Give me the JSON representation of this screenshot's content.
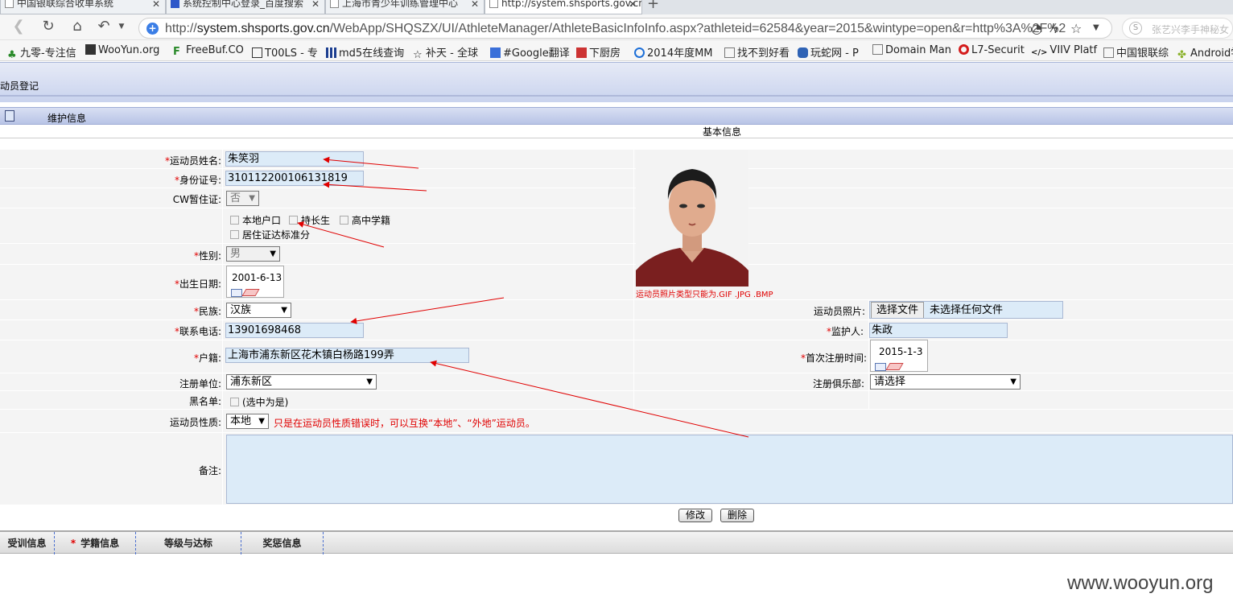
{
  "browser": {
    "tabs": [
      {
        "label": "中国银联综合收单系统"
      },
      {
        "label": "系统控制中心登录_百度搜索"
      },
      {
        "label": "上海市青少年训练管理中心"
      },
      {
        "label": "http://system.shsports.gov.cn"
      }
    ],
    "url_host": "system.shsports.gov.cn",
    "url_prefix": "http://",
    "url_path": "/WebApp/SHQSZX/UI/AthleteManager/AthleteBasicInfoInfo.aspx?athleteid=62584&year=2015&wintype=open&r=http%3A%2F%2",
    "profile_text": "张艺兴李手神秘女",
    "bookmarks": [
      {
        "label": "九零-专注信",
        "color": "#2a8a2a"
      },
      {
        "label": "WooYun.org",
        "color": "#222"
      },
      {
        "label": "FreeBuf.CO",
        "color": "#2a8a2a"
      },
      {
        "label": "T00LS - 专",
        "color": "#555"
      },
      {
        "label": "md5在线查询",
        "color": "#1b3d8f"
      },
      {
        "label": "补天 - 全球",
        "color": "#777"
      },
      {
        "label": "#Google翻译",
        "color": "#3a6fd9"
      },
      {
        "label": "下厨房",
        "color": "#c33"
      },
      {
        "label": "2014年度MM",
        "color": "#1d6fd8"
      },
      {
        "label": "找不到好看",
        "color": "#777"
      },
      {
        "label": "玩蛇网 - P",
        "color": "#2f63b5"
      },
      {
        "label": "Domain Man",
        "color": "#777"
      },
      {
        "label": "L7-Securit",
        "color": "#d41c1c"
      },
      {
        "label": "VIIV Platf",
        "color": "#222"
      },
      {
        "label": "中国银联综",
        "color": "#777"
      },
      {
        "label": "Android学",
        "color": "#8bb22c"
      }
    ]
  },
  "page": {
    "header_title": "动员登记",
    "subheader": "维护信息",
    "section_title": "基本信息",
    "labels": {
      "name": "运动员姓名:",
      "idcard": "身份证号:",
      "cw": "CW暂住证:",
      "gender": "性别:",
      "birth": "出生日期:",
      "nation": "民族:",
      "phone": "联系电话:",
      "hukou": "户籍:",
      "reg_unit": "注册单位:",
      "blacklist": "黑名单:",
      "nature": "运动员性质:",
      "remark": "备注:",
      "photo": "运动员照片:",
      "guardian": "监护人:",
      "first_reg": "首次注册时间:",
      "club": "注册俱乐部:"
    },
    "values": {
      "name": "朱笑羽",
      "idcard": "310112200106131819",
      "cw": "否",
      "gender": "男",
      "birth": "2001-6-13",
      "nation": "汉族",
      "phone": "13901698468",
      "hukou": "上海市浦东新区花木镇白杨路199弄",
      "reg_unit": "浦东新区",
      "blacklist_hint": "(选中为是)",
      "nature": "本地",
      "guardian": "朱政",
      "first_reg": "2015-1-3",
      "club": "请选择",
      "photo_btn": "选择文件",
      "photo_none": "未选择任何文件"
    },
    "checkboxes": [
      "本地户口",
      "持长生",
      "高中学籍",
      "居住证达标准分"
    ],
    "nature_hint": "只是在运动员性质错误时，可以互换“本地”、“外地”运动员。",
    "photo_hint": "运动员照片类型只能为.GIF .JPG .BMP",
    "buttons": {
      "edit": "修改",
      "delete": "删除"
    },
    "bottom_tabs": [
      "受训信息",
      "学籍信息",
      "等级与达标",
      "奖惩信息"
    ],
    "bottom_tab_marker": "*",
    "watermark": "www.wooyun.org"
  },
  "colors": {
    "required": "#e00000",
    "annotation": "#e00000",
    "input_bg": "#dcebf8"
  }
}
